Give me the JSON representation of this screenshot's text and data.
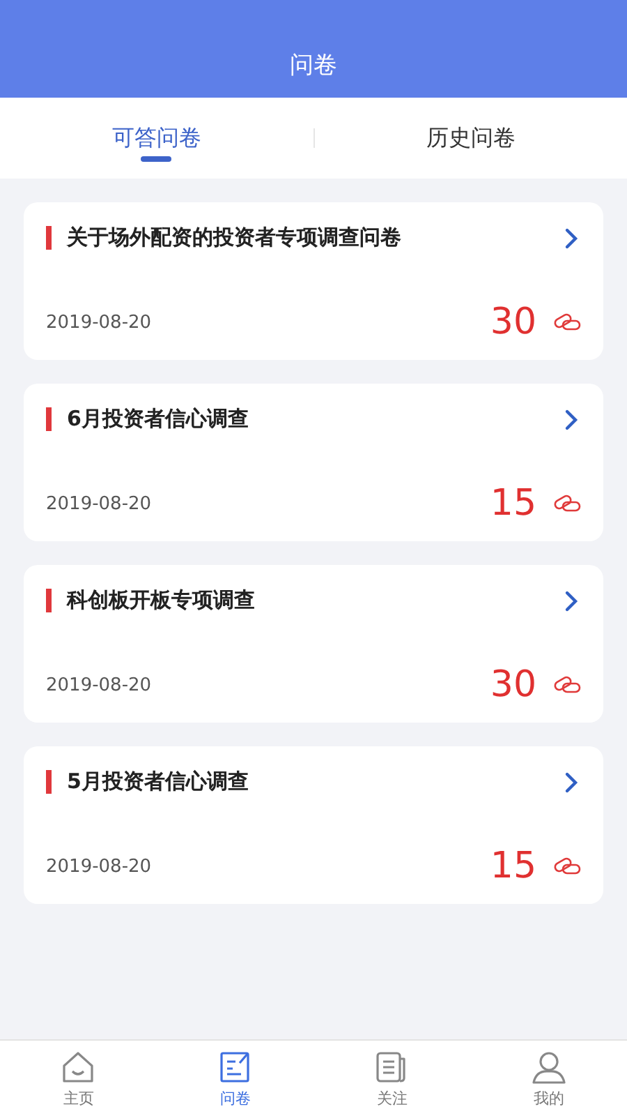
{
  "header": {
    "title": "问卷"
  },
  "tabs": [
    {
      "label": "可答问卷",
      "selected": true
    },
    {
      "label": "历史问卷",
      "selected": false
    }
  ],
  "surveys": [
    {
      "title": "关于场外配资的投资者专项调查问卷",
      "date": "2019-08-20",
      "points": "30"
    },
    {
      "title": "6月投资者信心调查",
      "date": "2019-08-20",
      "points": "15"
    },
    {
      "title": "科创板开板专项调查",
      "date": "2019-08-20",
      "points": "30"
    },
    {
      "title": "5月投资者信心调查",
      "date": "2019-08-20",
      "points": "15"
    }
  ],
  "nav": [
    {
      "label": "主页",
      "kind": "home",
      "selected": false
    },
    {
      "label": "问卷",
      "kind": "survey",
      "selected": true
    },
    {
      "label": "关注",
      "kind": "follow",
      "selected": false
    },
    {
      "label": "我的",
      "kind": "profile",
      "selected": false
    }
  ]
}
